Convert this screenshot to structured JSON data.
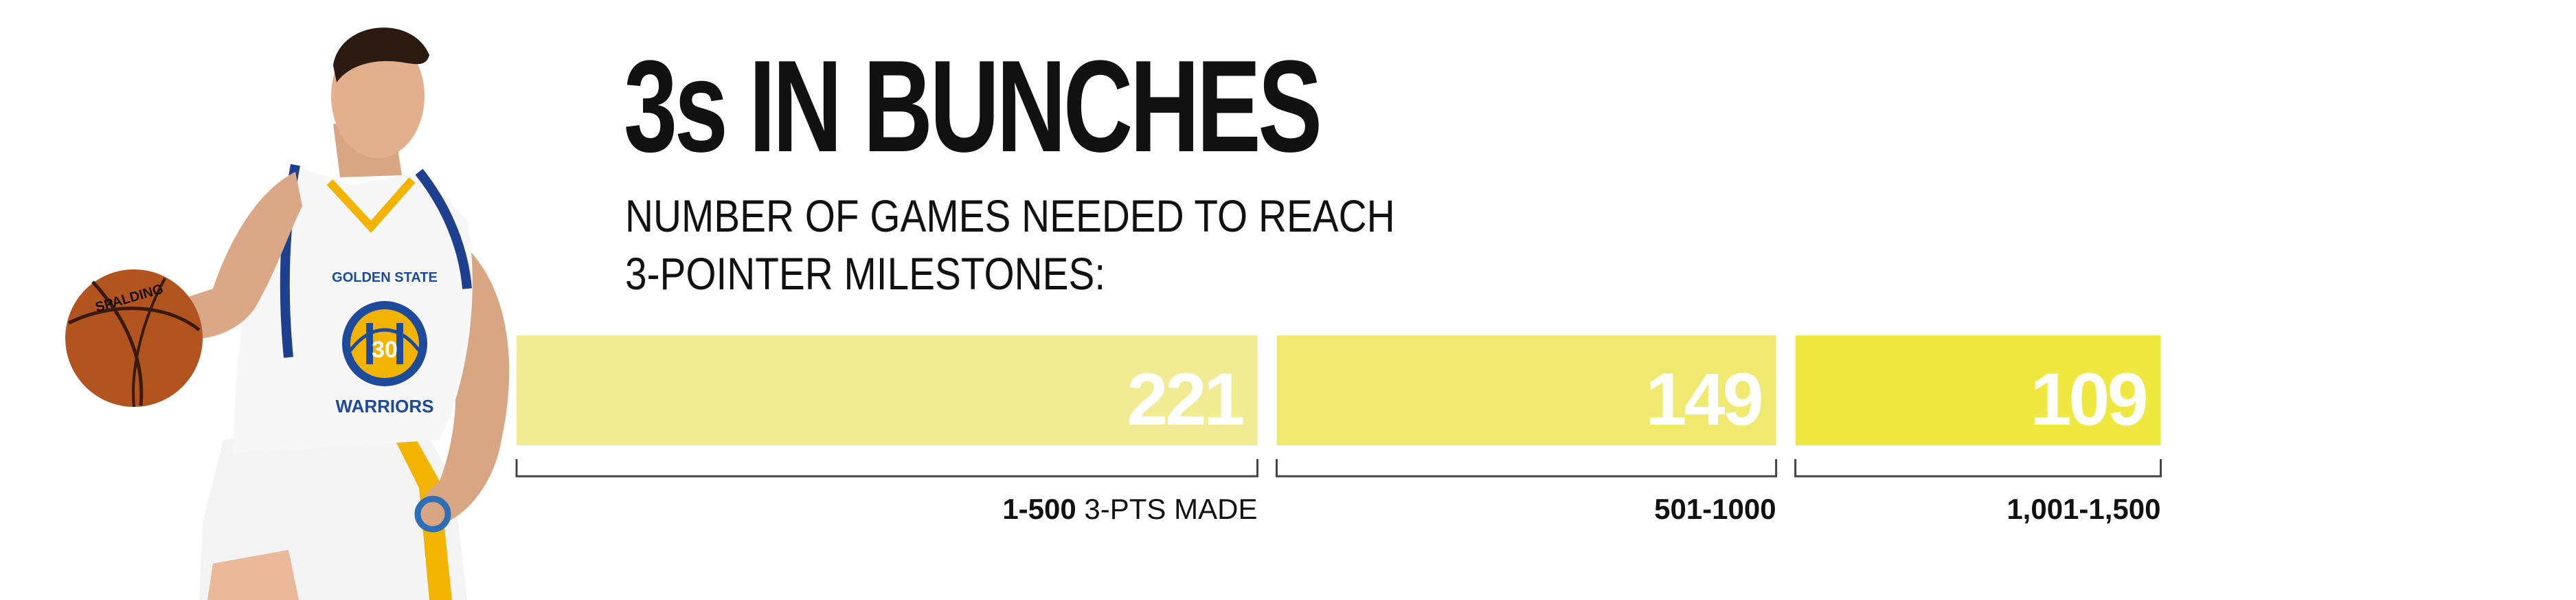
{
  "title": "3s IN BUNCHES",
  "subtitle_lines": [
    "NUMBER OF GAMES NEEDED TO REACH",
    "3-POINTER MILESTONES:"
  ],
  "colors": {
    "bar_1": "#f1ec93",
    "bar_2": "#efea6f",
    "bar_3": "#efe840",
    "value_text": "#ffffff",
    "bracket": "#444444",
    "text": "#111111"
  },
  "player_art": {
    "jersey_team_text": "GOLDEN STATE",
    "jersey_name_text": "WARRIORS",
    "jersey_number": "30",
    "ball_brand": "SPALDING"
  },
  "chart_data": {
    "type": "bar",
    "orientation": "horizontal-segmented",
    "title": "3s IN BUNCHES",
    "subtitle": "NUMBER OF GAMES NEEDED TO REACH 3-POINTER MILESTONES:",
    "categories": [
      "1-500",
      "501-1000",
      "1,001-1,500"
    ],
    "category_suffixes": [
      " 3-PTS MADE",
      "",
      ""
    ],
    "values": [
      221,
      149,
      109
    ],
    "data_labels": [
      "221",
      "149",
      "109"
    ],
    "grid": false,
    "legend": "none"
  }
}
